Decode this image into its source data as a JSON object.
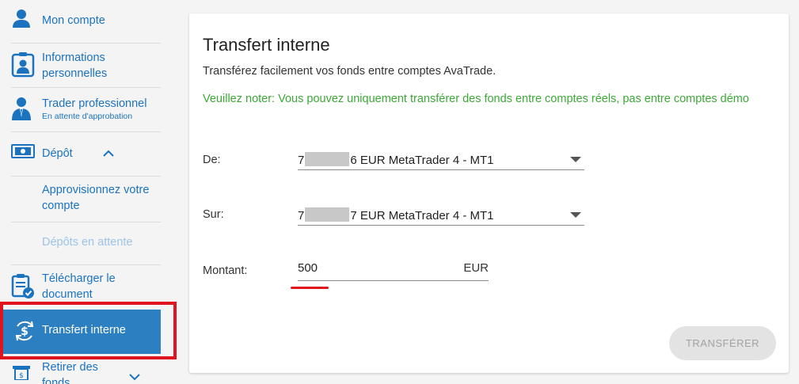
{
  "sidebar": {
    "items": [
      {
        "label": "Mon compte",
        "icon": "user-icon"
      },
      {
        "label": "Informations personnelles",
        "icon": "id-card-icon"
      },
      {
        "label": "Trader professionnel",
        "sub": "En attente d'approbation",
        "icon": "businessman-icon"
      },
      {
        "label": "Dépôt",
        "icon": "banknote-icon"
      },
      {
        "label": "Approvisionnez votre compte"
      },
      {
        "label": "Dépôts en attente"
      },
      {
        "label": "Télécharger le document",
        "icon": "clipboard-check-icon"
      },
      {
        "label": "Transfert interne",
        "icon": "dollar-transfer-icon"
      },
      {
        "label": "Retirer des fonds",
        "icon": "atm-withdraw-icon"
      }
    ]
  },
  "main": {
    "title": "Transfert interne",
    "subtitle": "Transférez facilement vos fonds entre comptes AvaTrade.",
    "note": "Veuillez noter: Vous pouvez uniquement transférer des fonds entre comptes réels, pas entre comptes démo",
    "from": {
      "label": "De:",
      "prefix": "7",
      "suffix": "6 EUR MetaTrader 4 - MT1"
    },
    "to": {
      "label": "Sur:",
      "prefix": "7",
      "suffix": "7 EUR MetaTrader 4 - MT1"
    },
    "amount": {
      "label": "Montant:",
      "value": "500",
      "currency": "EUR"
    },
    "submit_label": "TRANSFÉRER"
  },
  "colors": {
    "accent": "#1b73c0",
    "active_bg": "#2c7fc1",
    "note": "#3aaa35",
    "highlight": "#e0141e"
  }
}
